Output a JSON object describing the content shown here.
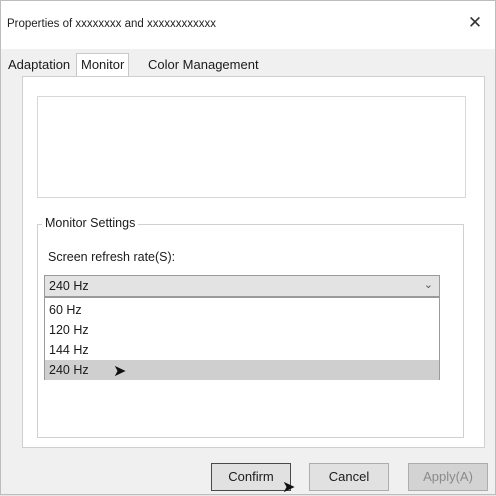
{
  "window": {
    "title": "Properties of xxxxxxxx and xxxxxxxxxxxx",
    "close_icon": "close-icon"
  },
  "tabs": [
    {
      "label": "Adaptation",
      "active": false
    },
    {
      "label": "Monitor",
      "active": true
    },
    {
      "label": "Color Management",
      "active": false
    }
  ],
  "monitor_settings": {
    "legend": "Monitor Settings",
    "refresh_label": "Screen refresh rate(S):",
    "selected_value": "240 Hz",
    "options": [
      "60 Hz",
      "120 Hz",
      "144 Hz",
      "240 Hz"
    ]
  },
  "buttons": {
    "confirm": "Confirm",
    "cancel": "Cancel",
    "apply": "Apply(A)"
  }
}
